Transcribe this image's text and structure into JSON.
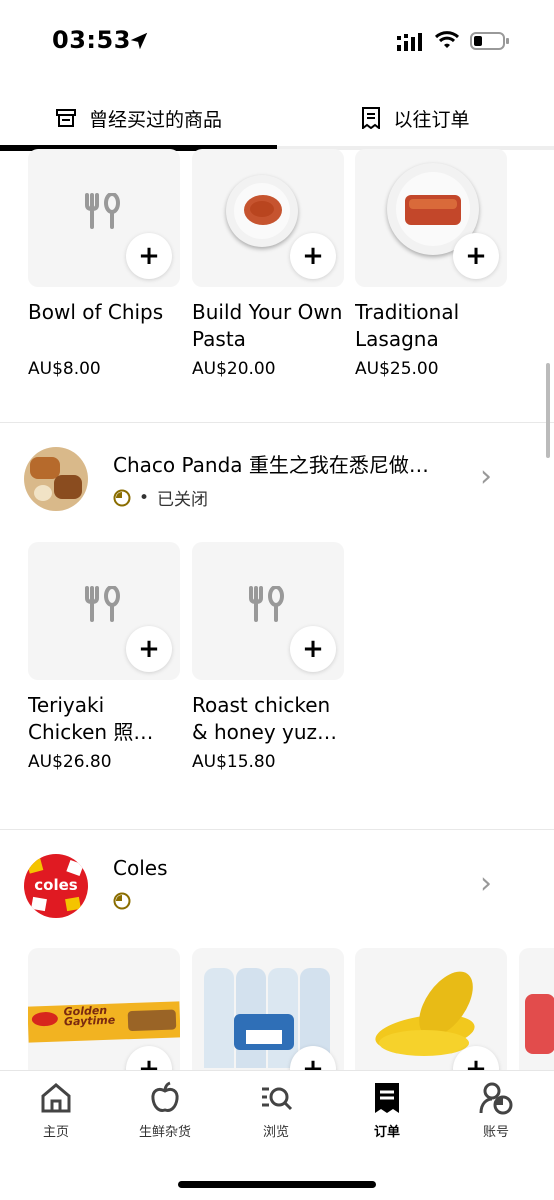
{
  "status_bar": {
    "time": "03:53"
  },
  "tabs": [
    {
      "label": "曾经买过的商品",
      "icon": "store-icon"
    },
    {
      "label": "以往订单",
      "icon": "receipt-icon"
    }
  ],
  "top_items": [
    {
      "name": "Bowl of Chips",
      "price": "AU$8.00",
      "image": "placeholder-fork-icon"
    },
    {
      "name": "Build Your Own Pasta",
      "price": "AU$20.00",
      "image": "pasta-plate"
    },
    {
      "name": "Traditional Lasagna",
      "price": "AU$25.00",
      "image": "lasagna-plate"
    }
  ],
  "stores": [
    {
      "name": "Chaco Panda 重生之我在悉尼做…",
      "status": "已关闭",
      "status_separator": "•",
      "items": [
        {
          "name": "Teriyaki Chicken 照…",
          "price": "AU$26.80"
        },
        {
          "name": "Roast chicken & honey yuz…",
          "price": "AU$15.80"
        }
      ]
    },
    {
      "name": "Coles",
      "logo_text": "coles",
      "items": [
        {
          "name": "Golden Gaytime Biscuits"
        },
        {
          "name": "Spring Water"
        },
        {
          "name": "Bananas"
        }
      ]
    }
  ],
  "add_label": "+",
  "chevron": "›",
  "bottom_nav": [
    {
      "label": "主页",
      "icon": "home-icon"
    },
    {
      "label": "生鲜杂货",
      "icon": "apple-icon"
    },
    {
      "label": "浏览",
      "icon": "browse-search-icon"
    },
    {
      "label": "订单",
      "icon": "receipt-icon",
      "active": true
    },
    {
      "label": "账号",
      "icon": "account-icon"
    }
  ],
  "colors": {
    "accent": "#000000",
    "closed_icon": "#8a6d00",
    "coles_red": "#e01a22"
  }
}
